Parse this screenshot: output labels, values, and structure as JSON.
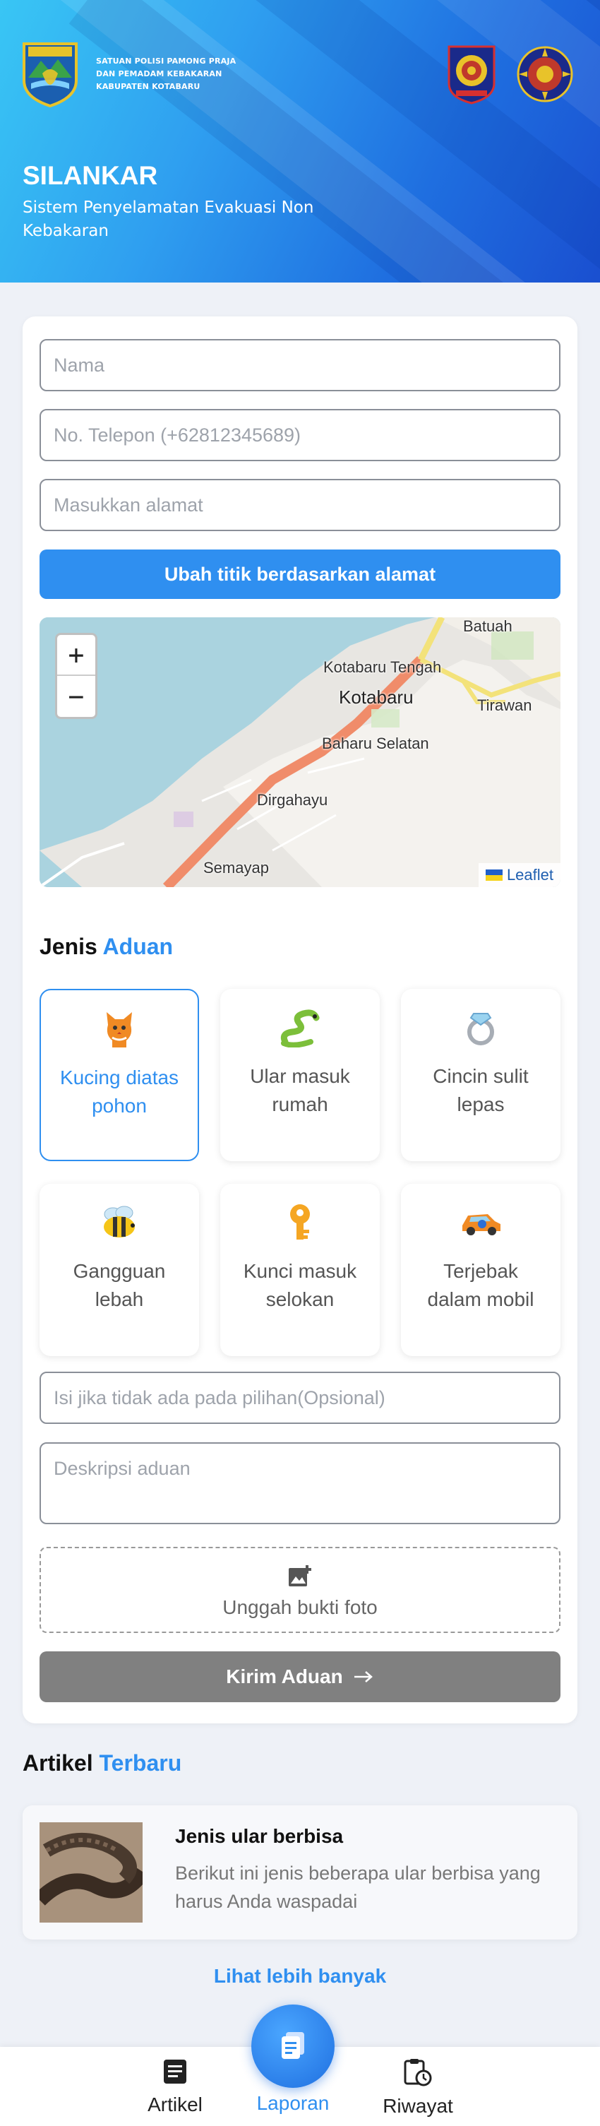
{
  "header": {
    "org_lines": [
      "SATUAN POLISI PAMONG PRAJA",
      "DAN PEMADAM KEBAKARAN",
      "KABUPATEN KOTABARU"
    ],
    "title": "SILANKAR",
    "subtitle": "Sistem Penyelamatan Evakuasi Non Kebakaran"
  },
  "form": {
    "name_placeholder": "Nama",
    "phone_placeholder": "No. Telepon (+62812345689)",
    "address_placeholder": "Masukkan alamat",
    "locate_button": "Ubah titik berdasarkan alamat",
    "map": {
      "zoom_in": "+",
      "zoom_out": "−",
      "labels": [
        "Batuah",
        "Kotabaru Tengah",
        "Kotabaru",
        "Tirawan",
        "Baharu Selatan",
        "Dirgahayu",
        "Semayap"
      ],
      "attribution": "Leaflet"
    },
    "types_title": "Jenis",
    "types_title_accent": "Aduan",
    "types": [
      {
        "label": "Kucing diatas pohon",
        "icon": "cat-icon",
        "selected": true
      },
      {
        "label": "Ular masuk rumah",
        "icon": "snake-icon",
        "selected": false
      },
      {
        "label": "Cincin sulit lepas",
        "icon": "ring-icon",
        "selected": false
      },
      {
        "label": "Gangguan lebah",
        "icon": "bee-icon",
        "selected": false
      },
      {
        "label": "Kunci masuk selokan",
        "icon": "key-icon",
        "selected": false
      },
      {
        "label": "Terjebak dalam mobil",
        "icon": "car-icon",
        "selected": false
      }
    ],
    "other_placeholder": "Isi jika tidak ada pada pilihan(Opsional)",
    "desc_placeholder": "Deskripsi aduan",
    "upload_label": "Unggah bukti foto",
    "submit_label": "Kirim Aduan"
  },
  "articles": {
    "title": "Artikel",
    "title_accent": "Terbaru",
    "items": [
      {
        "name": "Jenis ular berbisa",
        "desc": "Berikut ini jenis beberapa ular berbisa yang harus Anda waspadai"
      }
    ],
    "more_label": "Lihat lebih banyak"
  },
  "nav": {
    "items": [
      {
        "label": "Artikel",
        "icon": "article-icon"
      },
      {
        "label": "Laporan",
        "icon": "report-icon",
        "active": true
      },
      {
        "label": "Riwayat",
        "icon": "history-icon"
      }
    ]
  },
  "colors": {
    "accent": "#2f8ff0",
    "submit": "#808080"
  }
}
